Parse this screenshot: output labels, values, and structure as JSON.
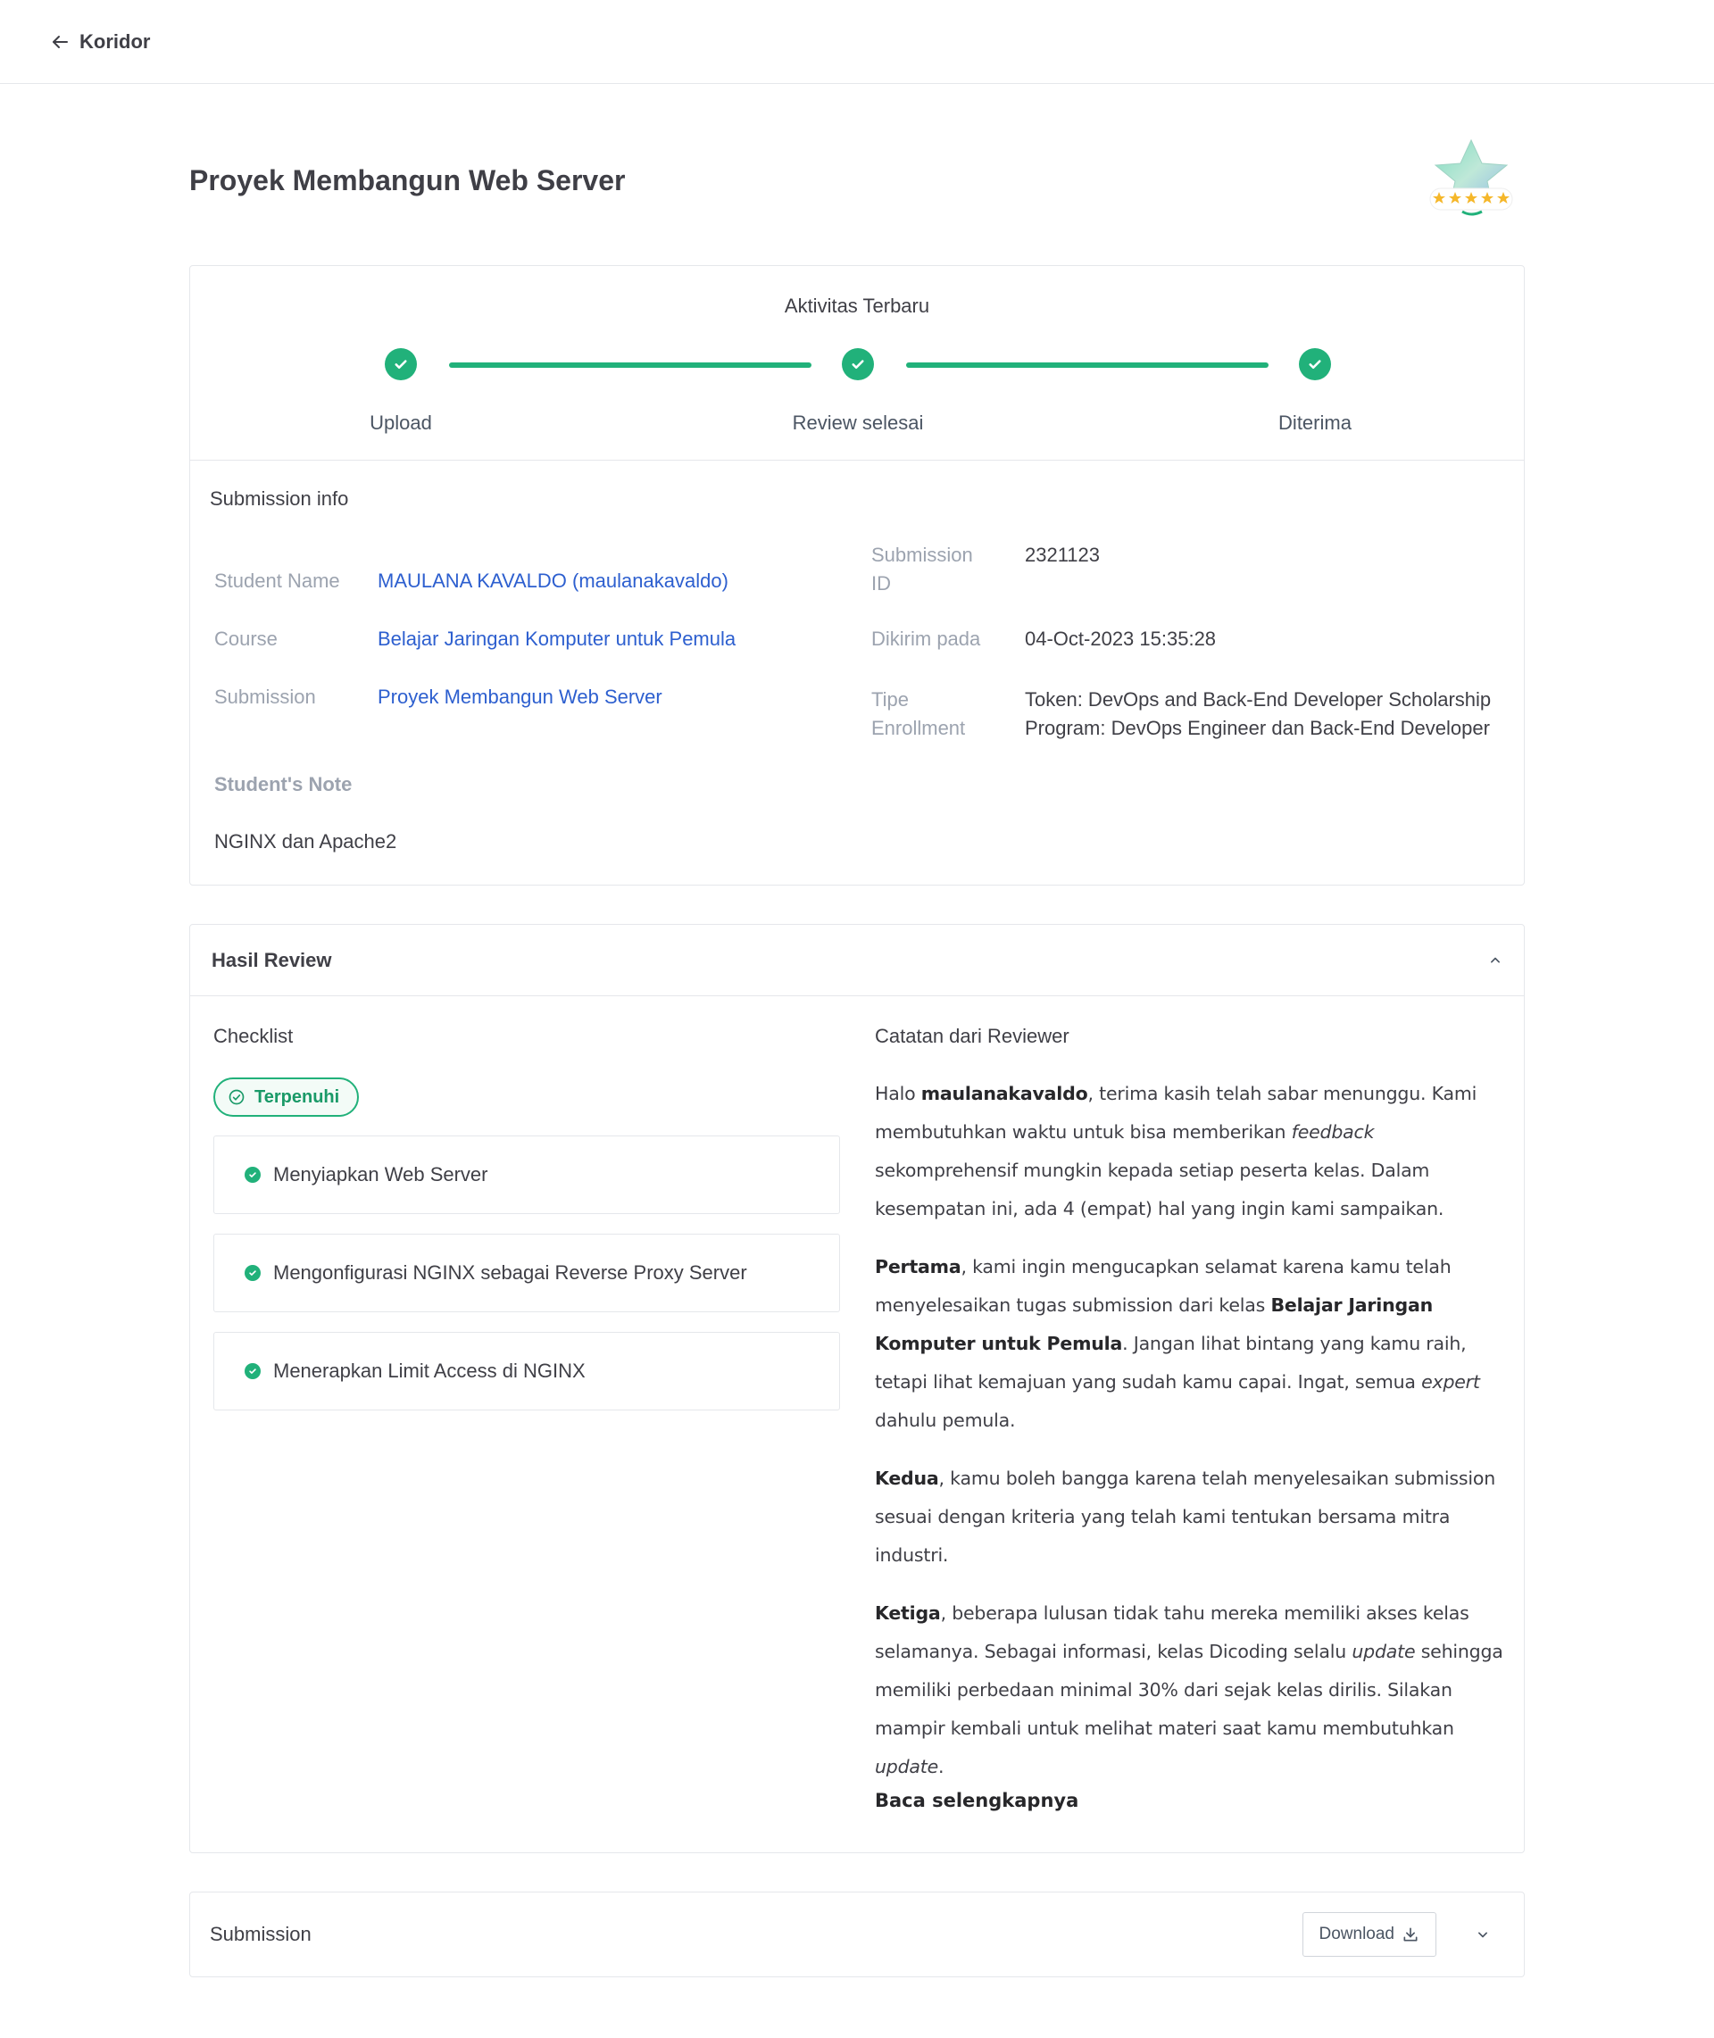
{
  "nav": {
    "back_label": "Koridor"
  },
  "page": {
    "title": "Proyek Membangun Web Server"
  },
  "activity": {
    "title": "Aktivitas Terbaru",
    "steps": [
      {
        "label": "Upload"
      },
      {
        "label": "Review selesai"
      },
      {
        "label": "Diterima"
      }
    ]
  },
  "submission_info": {
    "title": "Submission info",
    "student_name_label": "Student Name",
    "student_name": "MAULANA KAVALDO (maulanakavaldo)",
    "course_label": "Course",
    "course": "Belajar Jaringan Komputer untuk Pemula",
    "submission_label": "Submission",
    "submission": "Proyek Membangun Web Server",
    "submission_id_label_1": "Submission",
    "submission_id_label_2": "ID",
    "submission_id": "2321123",
    "sent_label": "Dikirim pada",
    "sent": "04-Oct-2023 15:35:28",
    "enrollment_label_1": "Tipe",
    "enrollment_label_2": "Enrollment",
    "enrollment_1": "Token: DevOps and Back-End Developer Scholarship",
    "enrollment_2": "Program: DevOps Engineer dan Back-End Developer",
    "note_label": "Student's Note",
    "note": "NGINX dan Apache2"
  },
  "review": {
    "title": "Hasil Review",
    "checklist_title": "Checklist",
    "status": "Terpenuhi",
    "items": [
      "Menyiapkan Web Server",
      "Mengonfigurasi NGINX sebagai Reverse Proxy Server",
      "Menerapkan Limit Access di NGINX"
    ],
    "notes_title": "Catatan dari Reviewer",
    "p1_a": "Halo ",
    "p1_b": "maulanakavaldo",
    "p1_c": ", terima kasih telah sabar menunggu. Kami membutuhkan waktu untuk bisa memberikan ",
    "p1_d": "feedback",
    "p1_e": " sekomprehensif mungkin kepada setiap peserta kelas. Dalam kesempatan ini, ada 4 (empat) hal yang ingin kami sampaikan.",
    "p2_a": "Pertama",
    "p2_b": ", kami ingin mengucapkan selamat karena kamu telah menyelesaikan tugas submission dari kelas ",
    "p2_c": "Belajar Jaringan Komputer untuk Pemula",
    "p2_d": ". Jangan lihat bintang yang kamu raih, tetapi lihat kemajuan yang sudah kamu capai. Ingat, semua ",
    "p2_e": "expert",
    "p2_f": " dahulu pemula.",
    "p3_a": "Kedua",
    "p3_b": ", kamu boleh bangga karena telah menyelesaikan submission sesuai dengan kriteria yang telah kami tentukan bersama mitra industri.",
    "p4_a": "Ketiga",
    "p4_b": ", beberapa lulusan tidak tahu mereka memiliki akses kelas selamanya. Sebagai informasi, kelas Dicoding selalu ",
    "p4_c": "update",
    "p4_d": " sehingga memiliki perbedaan minimal 30% dari sejak kelas dirilis. Silakan mampir kembali untuk melihat materi saat kamu membutuhkan ",
    "p4_e": "update",
    "p4_f": ".",
    "read_more": "Baca selengkapnya"
  },
  "submission_section": {
    "title": "Submission",
    "download_label": "Download"
  },
  "rating": {
    "stars": 5,
    "max": 5
  },
  "colors": {
    "accent": "#21b17a",
    "link": "#2d5fcf",
    "star": "#f5b72a"
  }
}
